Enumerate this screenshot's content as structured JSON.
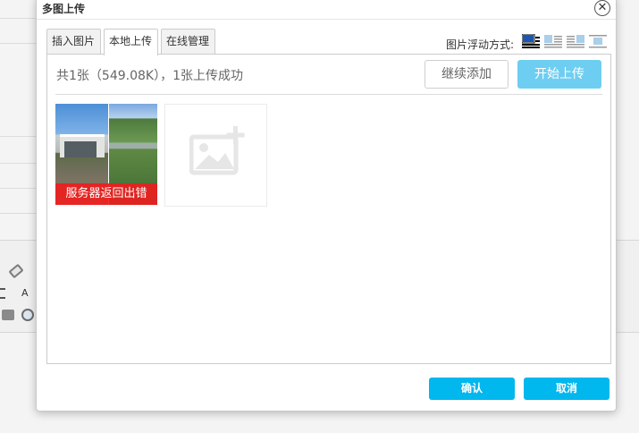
{
  "dialog": {
    "title": "多图上传",
    "close_glyph": "✕"
  },
  "tabs": [
    {
      "label": "插入图片",
      "active": false
    },
    {
      "label": "本地上传",
      "active": true
    },
    {
      "label": "在线管理",
      "active": false
    }
  ],
  "float": {
    "label": "图片浮动方式:",
    "options": [
      "none-icon",
      "left-icon",
      "right-icon",
      "center-icon"
    ]
  },
  "upload": {
    "status": "共1张（549.08K），1张上传成功",
    "continue_label": "继续添加",
    "start_label": "开始上传",
    "file": {
      "error_text": "服务器返回出错"
    }
  },
  "footer": {
    "ok_label": "确认",
    "cancel_label": "取消"
  },
  "background": {
    "toolbar_font_glyph": "A"
  },
  "colors": {
    "accent": "#00b7ee",
    "start_button": "#5fc9f0",
    "error": "#eb1e1e"
  }
}
